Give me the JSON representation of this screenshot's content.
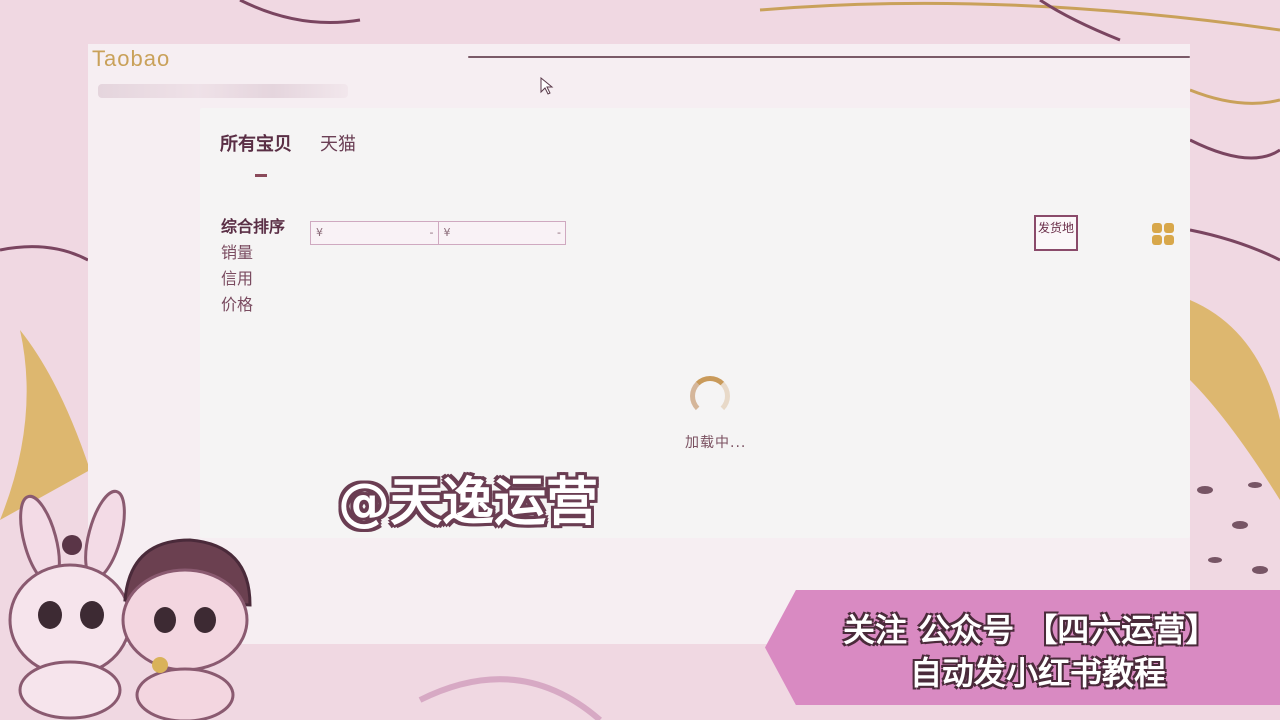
{
  "window": {
    "logo": "Taobao"
  },
  "tabs": [
    {
      "label": "所有宝贝",
      "active": true
    },
    {
      "label": "天猫",
      "active": false
    }
  ],
  "sort": [
    {
      "label": "综合排序",
      "active": true
    },
    {
      "label": "销量",
      "active": false
    },
    {
      "label": "信用",
      "active": false
    },
    {
      "label": "价格",
      "active": false
    }
  ],
  "price_filter": {
    "min_prefix": "¥",
    "min_suffix": "-",
    "max_prefix": "¥",
    "max_suffix": "-"
  },
  "ship_from": {
    "label": "发货地"
  },
  "loading": {
    "text": "加载中..."
  },
  "watermark": {
    "text": "@天逸运营"
  },
  "promo": {
    "line1": "关注 公众号 【四六运营】",
    "line2": "自动发小红书教程"
  },
  "colors": {
    "background": "#f0d8e2",
    "accent_gold": "#c9a15a",
    "promo_pink": "#d98ac2",
    "text_plum": "#5a2e45"
  }
}
